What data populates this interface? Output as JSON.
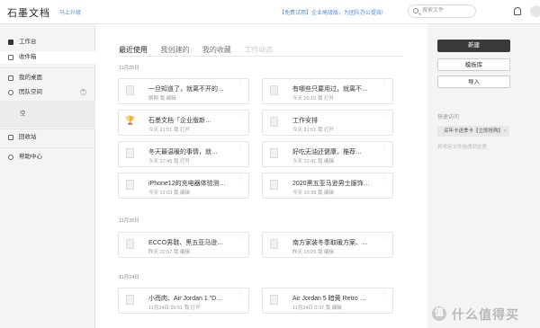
{
  "header": {
    "logo": "石墨文档",
    "upgrade_link": "马上升级",
    "promo": "【免费试用】企业高级版，为团队办公提效!",
    "search_placeholder": "搜索文件"
  },
  "sidebar": {
    "items": [
      {
        "label": "工作台"
      },
      {
        "label": "收件箱"
      },
      {
        "label": "我的桌面"
      },
      {
        "label": "团队空间"
      },
      {
        "label": "回收站"
      },
      {
        "label": "帮助中心"
      }
    ],
    "empty_label": "空"
  },
  "main": {
    "tabs": [
      {
        "label": "最近使用"
      },
      {
        "label": "我创建的"
      },
      {
        "label": "我的收藏"
      },
      {
        "label": "工作动态"
      }
    ],
    "groups": [
      {
        "date": "11月26日",
        "cards": [
          {
            "title": "一旦知道了，就离不开的…",
            "meta": "刚刚 我 编辑",
            "icon": "doc"
          },
          {
            "title": "有哪些只要用过，就离不…",
            "meta": "今天 20:15 我 打开",
            "icon": "doc"
          },
          {
            "title": "石墨文档「企业版新…",
            "meta": "今天 21:51 我 打开",
            "icon": "emoji"
          },
          {
            "title": "工作安排",
            "meta": "今天 21:51 我 打开",
            "icon": "doc"
          },
          {
            "title": "冬天最温暖的事情，就…",
            "meta": "今天 17:45 我 打开",
            "icon": "doc"
          },
          {
            "title": "好吃无油还健康，推荐…",
            "meta": "今天 12:41 我 编辑",
            "icon": "doc"
          },
          {
            "title": "iPhone12的充电器体验测…",
            "meta": "今天 12:03 我 编辑",
            "icon": "doc"
          },
          {
            "title": "2020黑五亚马逊男士服饰…",
            "meta": "今天 10:38 我 编辑",
            "icon": "doc"
          }
        ]
      },
      {
        "date": "11月25日",
        "cards": [
          {
            "title": "ECCO男鞋、黑五亚马逊…",
            "meta": "昨天 22:57 我 编辑",
            "icon": "doc"
          },
          {
            "title": "南方家装冬季取暖方案、…",
            "meta": "昨天 15:29 我 编辑",
            "icon": "doc"
          }
        ]
      },
      {
        "date": "11月24日",
        "cards": [
          {
            "title": "小而肉、Air Jordan 1 \"D…",
            "meta": "11月24日 16:51 我 打开",
            "icon": "doc"
          },
          {
            "title": "Air Jordan 5 暗黄 Retro …",
            "meta": "11月24日 0:37 我 编辑",
            "icon": "doc"
          }
        ]
      }
    ]
  },
  "right": {
    "new_label": "新建",
    "template_label": "模板库",
    "import_label": "导入",
    "quick_access_title": "快速访问",
    "quick_chip": "买年卡送季卡【立即抢购】",
    "quick_hint": "将常用文件拖拽到这里"
  },
  "watermark": {
    "badge": "值",
    "text": "什么值得买"
  }
}
